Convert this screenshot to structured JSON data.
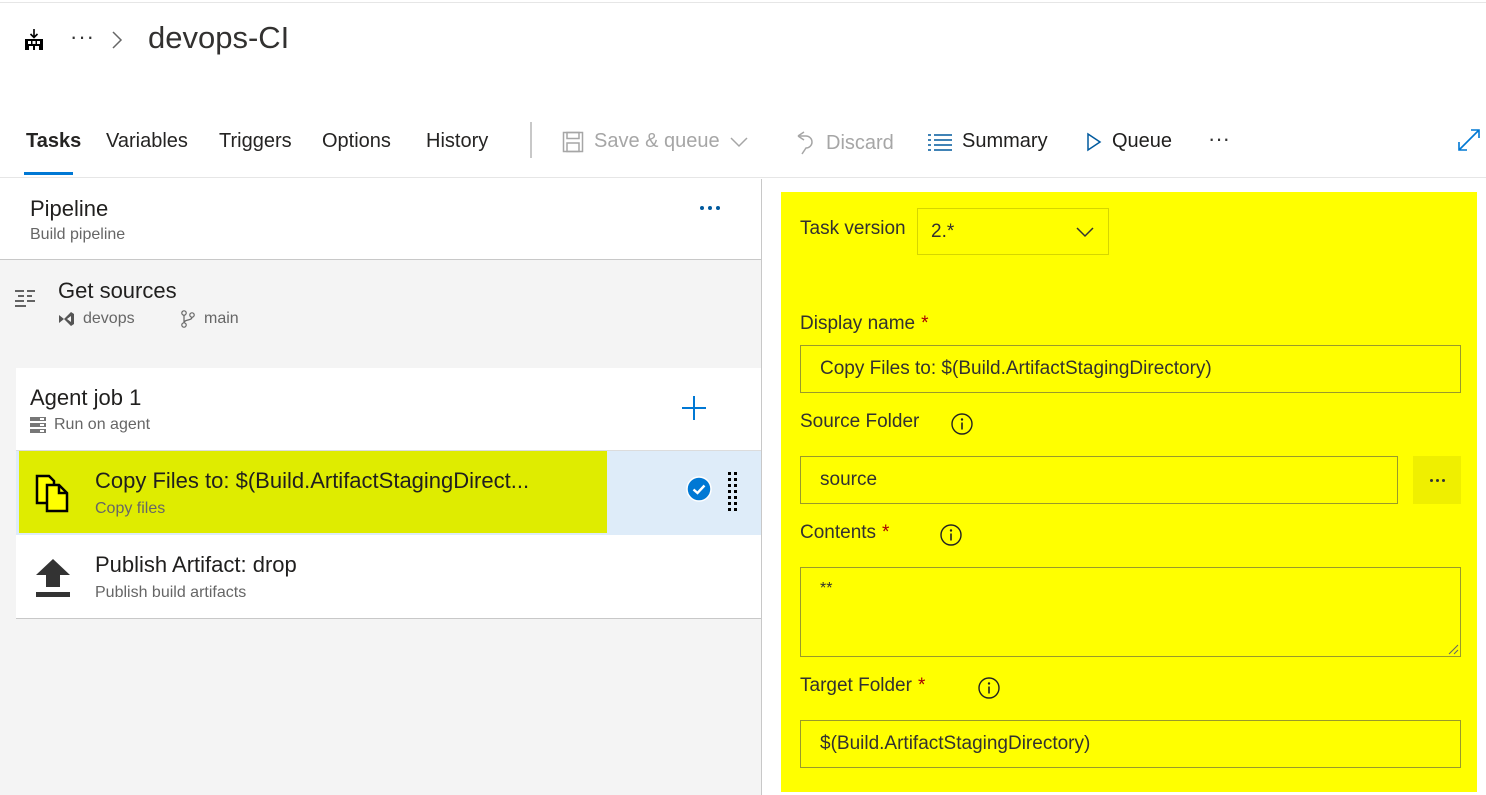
{
  "header": {
    "breadcrumb_ellipsis": "···",
    "title": "devops-CI"
  },
  "tabs": [
    {
      "label": "Tasks",
      "active": true
    },
    {
      "label": "Variables",
      "active": false
    },
    {
      "label": "Triggers",
      "active": false
    },
    {
      "label": "Options",
      "active": false
    },
    {
      "label": "History",
      "active": false
    }
  ],
  "toolbar": {
    "save_queue_label": "Save & queue",
    "discard_label": "Discard",
    "summary_label": "Summary",
    "queue_label": "Queue",
    "more_label": "···"
  },
  "pipeline": {
    "title": "Pipeline",
    "subtitle": "Build pipeline"
  },
  "get_sources": {
    "title": "Get sources",
    "repo": "devops",
    "branch": "main"
  },
  "agent_job": {
    "title": "Agent job 1",
    "subtitle": "Run on agent"
  },
  "tasks": [
    {
      "title": "Copy Files to: $(Build.ArtifactStagingDirect...",
      "subtitle": "Copy files",
      "selected": true
    },
    {
      "title": "Publish Artifact: drop",
      "subtitle": "Publish build artifacts",
      "selected": false
    }
  ],
  "task_form": {
    "task_version_label": "Task version",
    "task_version_value": "2.*",
    "display_name_label": "Display name",
    "display_name_value": "Copy Files to: $(Build.ArtifactStagingDirectory)",
    "source_folder_label": "Source Folder",
    "source_folder_value": "source",
    "contents_label": "Contents",
    "contents_value": "**",
    "target_folder_label": "Target Folder",
    "target_folder_value": "$(Build.ArtifactStagingDirectory)",
    "required_marker": "*"
  },
  "colors": {
    "accent": "#0078d4",
    "form_highlight": "#ffff00",
    "task_highlight": "#dfec00",
    "selected_row": "#deecf9",
    "required": "#a80000"
  }
}
